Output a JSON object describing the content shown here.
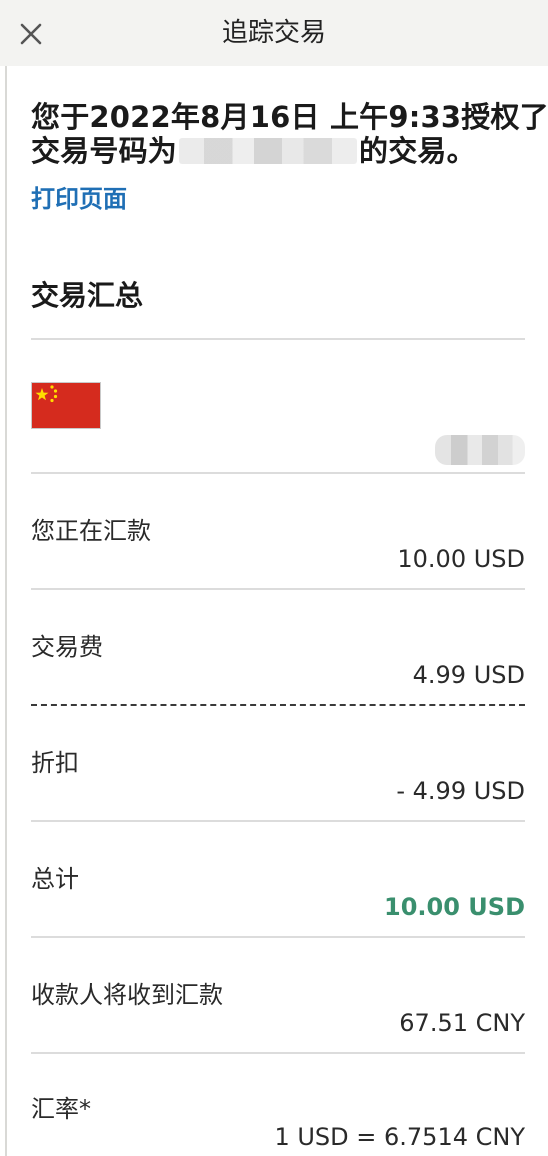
{
  "header": {
    "title": "追踪交易",
    "close_icon": "close-icon"
  },
  "notice": {
    "line1": "您于2022年8月16日 上午9:33授权了",
    "line2_prefix": "交易号码为",
    "line2_suffix": "的交易。"
  },
  "actions": {
    "print_label": "打印页面"
  },
  "summary": {
    "title": "交易汇总",
    "flag_icon": "china-flag-icon",
    "rows": [
      {
        "label": "您正在汇款",
        "value": "10.00 USD"
      },
      {
        "label": "交易费",
        "value": "4.99 USD"
      },
      {
        "label": "折扣",
        "value": "- 4.99 USD"
      },
      {
        "label": "总计",
        "value": "10.00 USD"
      },
      {
        "label": "收款人将收到汇款",
        "value": "67.51 CNY"
      },
      {
        "label": "汇率*",
        "value": "1 USD = 6.7514 CNY"
      }
    ]
  },
  "colors": {
    "link": "#1f6fb5",
    "total": "#3a8f6e",
    "header_bg": "#f3f3f1"
  }
}
